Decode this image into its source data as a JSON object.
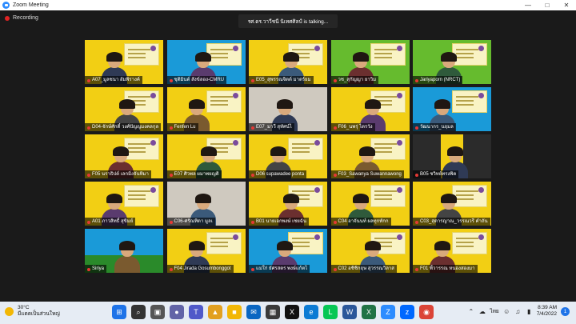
{
  "window": {
    "title": "Zoom Meeting"
  },
  "recording": {
    "label": "Recording"
  },
  "speaker_banner": "รศ.ดร.วาวีชนี นิเทศศิลป์ is  talking...",
  "participants": [
    {
      "name": "A07_มูลชนา อัมพิรางค์",
      "bg": "yellow"
    },
    {
      "name": "ชุติมินต์ สังข์ลอง-CMRU",
      "bg": "blue"
    },
    {
      "name": "E05_สุพรรณจิตต์ มาตร์ยม",
      "bg": "yellow"
    },
    {
      "name": "วช_สุกัญญา ยาวิม",
      "bg": "green"
    },
    {
      "name": "Jariyaporn (NRCT)",
      "bg": "green"
    },
    {
      "name": "D04-จักษ์ศักดิ์ วงศ์ปัญญมงคลกุล",
      "bg": "yellow"
    },
    {
      "name": "Fenfen Lu",
      "bg": "yellow"
    },
    {
      "name": "E07_มาวี สุทัศน์ไ",
      "bg": "room"
    },
    {
      "name": "F06_นพรุ่ ไตรวัง",
      "bg": "yellow"
    },
    {
      "name": "วัฒนากร_นฤมล",
      "bg": "blue"
    },
    {
      "name": "F05 นราธิปต์ เลกมิ่งจันทิมา",
      "bg": "yellow"
    },
    {
      "name": "E07 ศิวพล  ผมาพยญติ",
      "bg": "yellow"
    },
    {
      "name": "D06 supawadee ponta",
      "bg": "yellow"
    },
    {
      "name": "F03_Sawanya Suwannawong",
      "bg": "yellow"
    },
    {
      "name": "B05 ชวิทย์ทรงพิต",
      "bg": "ybar"
    },
    {
      "name": "A01 ภาวสิทธิ์ สุขิมย์",
      "bg": "yellow"
    },
    {
      "name": "C06-ศรัณทิดา มูลเ",
      "bg": "room"
    },
    {
      "name": "B01 นายเอกพงษ์ เชยฉัน",
      "bg": "yellow"
    },
    {
      "name": "C04 อาจันนท์ ผลทุกทักก",
      "bg": "yellow"
    },
    {
      "name": "C03_สุดารญาณ_วรรณวรี คำถัน",
      "bg": "yellow"
    },
    {
      "name": "Siriya",
      "bg": "green2"
    },
    {
      "name": "F04 Jirada Gosumbonggot",
      "bg": "yellow"
    },
    {
      "name": "แม่ใก่ ยัศรสตร พงษ์แก้ตไ",
      "bg": "blue"
    },
    {
      "name": "C02 อชิชิกฤษ สุวรรณวิลาส",
      "bg": "yellow"
    },
    {
      "name": "F01 พิ้วารรณ หนองสองมา",
      "bg": "yellow"
    }
  ],
  "taskbar": {
    "weather_temp": "30°C",
    "weather_desc": "มีแดดเป็นส่วนใหญ่",
    "apps": [
      "start-icon",
      "search-icon",
      "task-view-icon",
      "chat-icon",
      "teams-icon",
      "photos-icon",
      "file-explorer-icon",
      "mail-icon",
      "store-icon",
      "xm-icon",
      "edge-icon",
      "line-icon",
      "word-icon",
      "excel-icon",
      "zoom-icon",
      "zalo-icon",
      "chrome-icon"
    ],
    "tray_lang": "ไทย",
    "time": "8:39 AM",
    "date": "7/4/2022",
    "notifications": "1"
  },
  "colors": {
    "yellow": "#f2cf14",
    "green": "#66bb2e",
    "blue": "#1a9ad8",
    "taskbar": "#e6ecf4"
  }
}
